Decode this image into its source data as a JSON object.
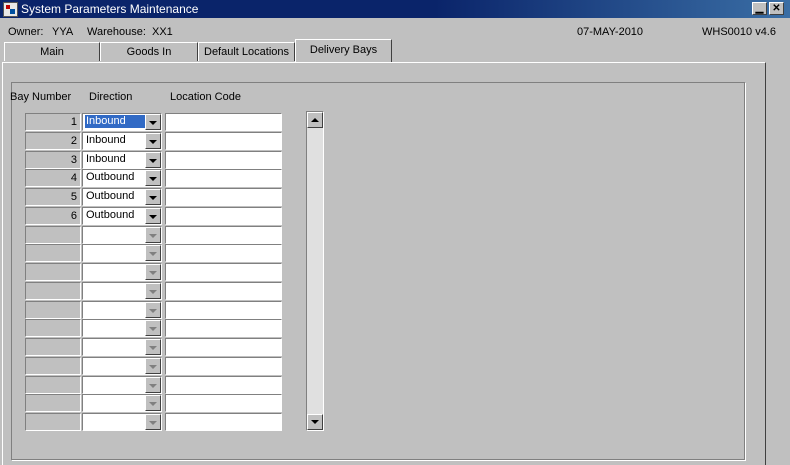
{
  "window": {
    "title": "System Parameters Maintenance",
    "minimize_glyph": "▁",
    "close_glyph": "✕"
  },
  "info": {
    "owner_label": "Owner:",
    "owner": "YYA",
    "warehouse_label": "Warehouse:",
    "warehouse": "XX1",
    "date": "07-MAY-2010",
    "version": "WHS0010  v4.6"
  },
  "tabs": [
    {
      "label": "Main"
    },
    {
      "label": "Goods In"
    },
    {
      "label": "Default Locations"
    },
    {
      "label": "Delivery Bays",
      "active": true
    }
  ],
  "grid": {
    "headers": {
      "bay_number": "Bay Number",
      "direction": "Direction",
      "location_code": "Location Code"
    },
    "rows": [
      {
        "bay": "1",
        "direction": "Inbound",
        "location": ""
      },
      {
        "bay": "2",
        "direction": "Inbound",
        "location": ""
      },
      {
        "bay": "3",
        "direction": "Inbound",
        "location": ""
      },
      {
        "bay": "4",
        "direction": "Outbound",
        "location": ""
      },
      {
        "bay": "5",
        "direction": "Outbound",
        "location": ""
      },
      {
        "bay": "6",
        "direction": "Outbound",
        "location": ""
      },
      {
        "bay": "",
        "direction": "",
        "location": ""
      },
      {
        "bay": "",
        "direction": "",
        "location": ""
      },
      {
        "bay": "",
        "direction": "",
        "location": ""
      },
      {
        "bay": "",
        "direction": "",
        "location": ""
      },
      {
        "bay": "",
        "direction": "",
        "location": ""
      },
      {
        "bay": "",
        "direction": "",
        "location": ""
      },
      {
        "bay": "",
        "direction": "",
        "location": ""
      },
      {
        "bay": "",
        "direction": "",
        "location": ""
      },
      {
        "bay": "",
        "direction": "",
        "location": ""
      },
      {
        "bay": "",
        "direction": "",
        "location": ""
      },
      {
        "bay": "",
        "direction": "",
        "location": ""
      }
    ]
  },
  "colors": {
    "titlebar": "#0a246a",
    "face": "#c0c0c0",
    "selection": "#316ac5"
  }
}
